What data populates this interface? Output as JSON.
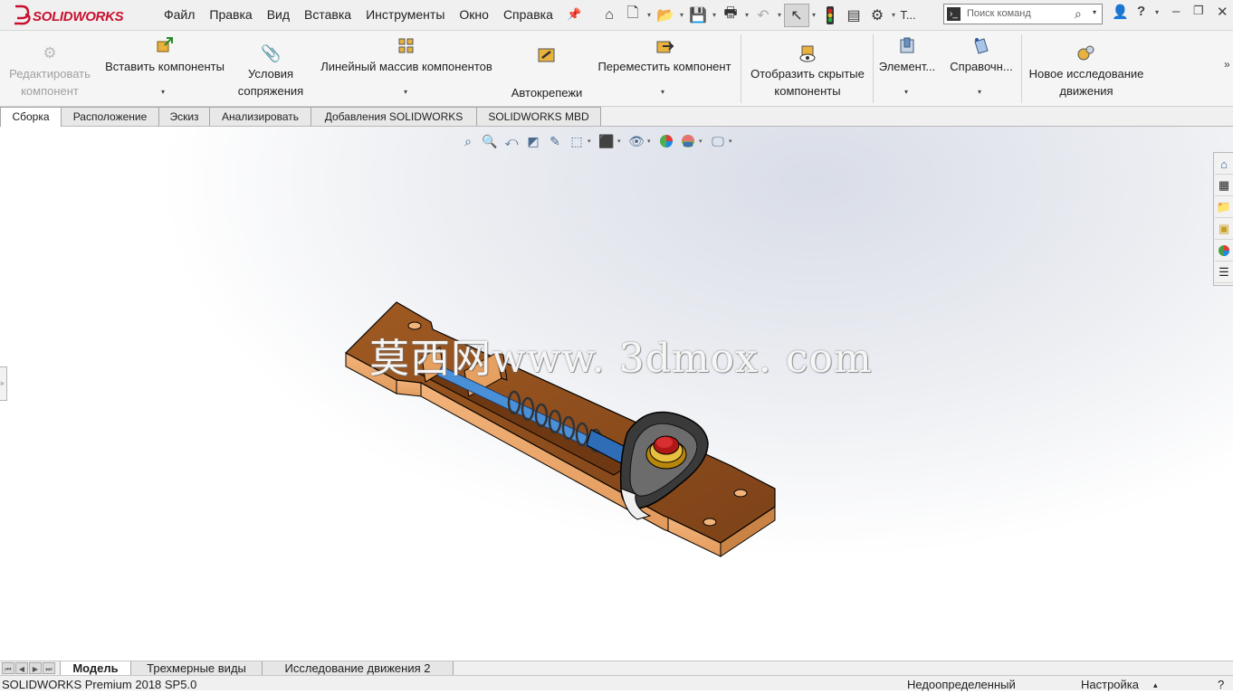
{
  "app": {
    "brand": "SOLIDWORKS",
    "brand_color": "#c8102e"
  },
  "menu": [
    "Файл",
    "Правка",
    "Вид",
    "Вставка",
    "Инструменты",
    "Окно",
    "Справка"
  ],
  "toolbar": {
    "truncated_label": "Т...",
    "search_placeholder": "Поиск команд"
  },
  "ribbon": {
    "edit_component": [
      "Редактировать",
      "компонент"
    ],
    "insert_components": "Вставить компоненты",
    "mate": [
      "Условия",
      "сопряжения"
    ],
    "linear_pattern": "Линейный массив компонентов",
    "fasteners": "Автокрепежи",
    "move_component": "Переместить компонент",
    "show_hidden": [
      "Отобразить скрытые",
      "компоненты"
    ],
    "elements": "Элемент...",
    "reference": "Справочн...",
    "new_motion": [
      "Новое исследование",
      "движения"
    ]
  },
  "tabs": [
    "Сборка",
    "Расположение",
    "Эскиз",
    "Анализировать",
    "Добавления SOLIDWORKS",
    "SOLIDWORKS MBD"
  ],
  "active_tab": "Сборка",
  "watermark": "莫西网www. 3dmox. com",
  "bottom_tabs": [
    "Модель",
    "Трехмерные виды",
    "Исследование движения 2"
  ],
  "active_bottom_tab": "Модель",
  "status": {
    "version": "SOLIDWORKS Premium 2018 SP5.0",
    "state": "Недоопределенный",
    "customize": "Настройка"
  },
  "icons": {
    "home": "home-icon",
    "new": "new-document-icon",
    "open": "open-icon",
    "save": "save-icon",
    "print": "print-icon",
    "undo": "undo-icon",
    "select": "select-arrow-icon",
    "rebuild": "traffic-light-icon",
    "file_props": "file-properties-icon",
    "options": "gear-icon",
    "user": "user-icon",
    "help": "help-icon"
  }
}
